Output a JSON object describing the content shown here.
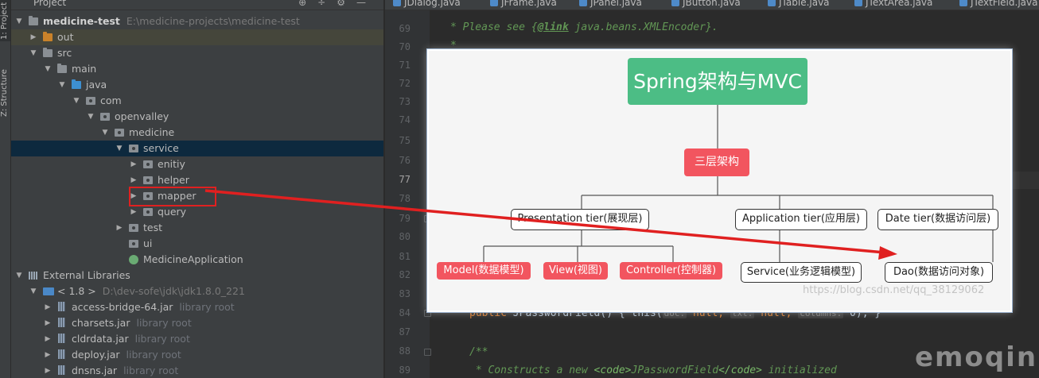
{
  "tool_strip": {
    "project_tab": "1: Project",
    "structure_tab": "Z: Structure"
  },
  "project_panel": {
    "title": "Project",
    "tree": [
      {
        "label": "medicine-test",
        "path": "E:\\medicine-projects\\medicine-test",
        "icon": "module-folder-icon"
      },
      {
        "label": "out",
        "icon": "orange-folder-icon"
      },
      {
        "label": "src",
        "icon": "folder-icon"
      },
      {
        "label": "main",
        "icon": "folder-icon"
      },
      {
        "label": "java",
        "icon": "source-folder-icon"
      },
      {
        "label": "com",
        "icon": "package-icon"
      },
      {
        "label": "openvalley",
        "icon": "package-icon"
      },
      {
        "label": "medicine",
        "icon": "package-icon"
      },
      {
        "label": "service",
        "icon": "package-icon"
      },
      {
        "label": "enitiy",
        "icon": "package-icon"
      },
      {
        "label": "helper",
        "icon": "package-icon"
      },
      {
        "label": "mapper",
        "icon": "package-icon"
      },
      {
        "label": "query",
        "icon": "package-icon"
      },
      {
        "label": "test",
        "icon": "folder-icon"
      },
      {
        "label": "ui",
        "icon": "folder-icon"
      },
      {
        "label": "MedicineApplication",
        "icon": "spring-class-icon"
      },
      {
        "label": "External Libraries",
        "icon": "libraries-icon"
      },
      {
        "label": "< 1.8 >",
        "path": "D:\\dev-sofe\\jdk\\jdk1.8.0_221",
        "icon": "jdk-icon"
      },
      {
        "label": "access-bridge-64.jar",
        "suffix": "library root",
        "icon": "jar-icon"
      },
      {
        "label": "charsets.jar",
        "suffix": "library root",
        "icon": "jar-icon"
      },
      {
        "label": "cldrdata.jar",
        "suffix": "library root",
        "icon": "jar-icon"
      },
      {
        "label": "deploy.jar",
        "suffix": "library root",
        "icon": "jar-icon"
      },
      {
        "label": "dnsns.jar",
        "suffix": "library root",
        "icon": "jar-icon"
      }
    ]
  },
  "editor": {
    "tabs": [
      "JDialog.java",
      "JFrame.java",
      "JPanel.java",
      "JButton.java",
      "JTable.java",
      "JTextArea.java",
      "JTextField.java"
    ],
    "line_numbers": [
      "69",
      "70",
      "71",
      "72",
      "73",
      "74",
      "75",
      "76",
      "77",
      "78",
      "79",
      "80",
      "81",
      "82",
      "83",
      "84",
      "87",
      "88",
      "89"
    ],
    "current_line": "77",
    "code": {
      "l69_prefix": "* Please see {",
      "l69_tag": "@link",
      "l69_rest": " java.beans.XMLEncoder}.",
      "l70": "*",
      "l84_kw": "public",
      "l84_name": " JPasswordField() { this(",
      "l84_hint1": "doc:",
      "l84_null1": " null, ",
      "l84_hint2": "txt:",
      "l84_null2": " null, ",
      "l84_hint3": "columns:",
      "l84_end": " 0); }",
      "l88": "/**",
      "l89_a": " * Constructs a new ",
      "l89_code1": "<code>",
      "l89_b": "JPasswordField",
      "l89_code2": "</code>",
      "l89_c": " initialized"
    }
  },
  "diagram": {
    "root": "Spring架构与MVC",
    "level1": "三层架构",
    "tiers": [
      "Presentation tier(展现层)",
      "Application tier(应用层)",
      "Date tier(数据访问层)"
    ],
    "leaves": [
      "Model(数据模型)",
      "View(视图)",
      "Controller(控制器)",
      "Service(业务逻辑模型)",
      "Dao(数据访问对象)"
    ],
    "watermark": "https://blog.csdn.net/qq_38129062",
    "colors": {
      "root": "#4cbd85",
      "red": "#f2555f",
      "arrow": "#e02020"
    }
  },
  "brand_watermark": "emoqin"
}
